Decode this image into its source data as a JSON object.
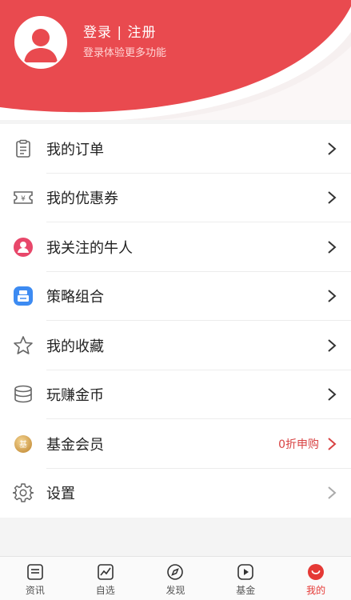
{
  "header": {
    "login_label": "登录 | 注册",
    "login_sub": "登录体验更多功能",
    "accent": "#e94a4f"
  },
  "menu": {
    "items": [
      {
        "label": "我的订单",
        "icon": "order-list-icon"
      },
      {
        "label": "我的优惠券",
        "icon": "coupon-icon"
      },
      {
        "label": "我关注的牛人",
        "icon": "followed-expert-icon"
      },
      {
        "label": "策略组合",
        "icon": "strategy-portfolio-icon"
      },
      {
        "label": "我的收藏",
        "icon": "star-icon"
      },
      {
        "label": "玩赚金币",
        "icon": "coin-stack-icon"
      },
      {
        "label": "基金会员",
        "icon": "fund-member-icon",
        "tag": "0折申购"
      },
      {
        "label": "设置",
        "icon": "gear-icon"
      }
    ]
  },
  "tabbar": {
    "tabs": [
      {
        "label": "资讯",
        "icon": "news-icon"
      },
      {
        "label": "自选",
        "icon": "watchlist-chart-icon"
      },
      {
        "label": "发现",
        "icon": "compass-icon"
      },
      {
        "label": "基金",
        "icon": "play-icon"
      },
      {
        "label": "我的",
        "icon": "profile-icon",
        "active": true
      }
    ]
  }
}
